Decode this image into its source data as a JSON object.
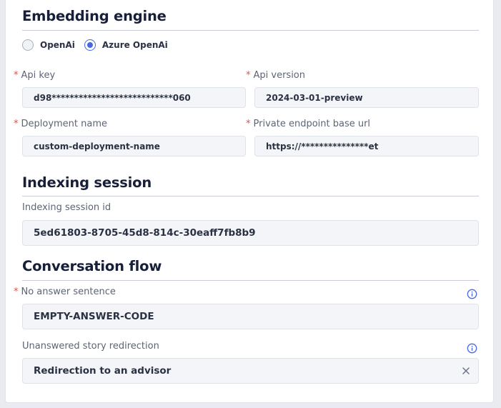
{
  "embedding": {
    "title": "Embedding engine",
    "radio_options": [
      {
        "label": "OpenAi",
        "checked": false
      },
      {
        "label": "Azure OpenAi",
        "checked": true
      }
    ],
    "required_marker": "*",
    "api_key": {
      "label": "Api key",
      "value": "d98***************************060"
    },
    "api_version": {
      "label": "Api version",
      "value": "2024-03-01-preview"
    },
    "deployment_name": {
      "label": "Deployment name",
      "value": "custom-deployment-name"
    },
    "endpoint": {
      "label": "Private endpoint base url",
      "value": "https://***************et"
    }
  },
  "indexing": {
    "title": "Indexing session",
    "session_id": {
      "label": "Indexing session id",
      "value": "5ed61803-8705-45d8-814c-30eaff7fb8b9"
    }
  },
  "conversation": {
    "title": "Conversation flow",
    "no_answer": {
      "label": "No answer sentence",
      "value": "EMPTY-ANSWER-CODE"
    },
    "redirection": {
      "label": "Unanswered story redirection",
      "value": "Redirection to an advisor"
    }
  },
  "colors": {
    "accent": "#4a66e6",
    "required": "#e2504a",
    "input_bg": "#f4f5f8"
  },
  "icons": {
    "info": "info-circle-icon",
    "clear": "close-icon"
  }
}
